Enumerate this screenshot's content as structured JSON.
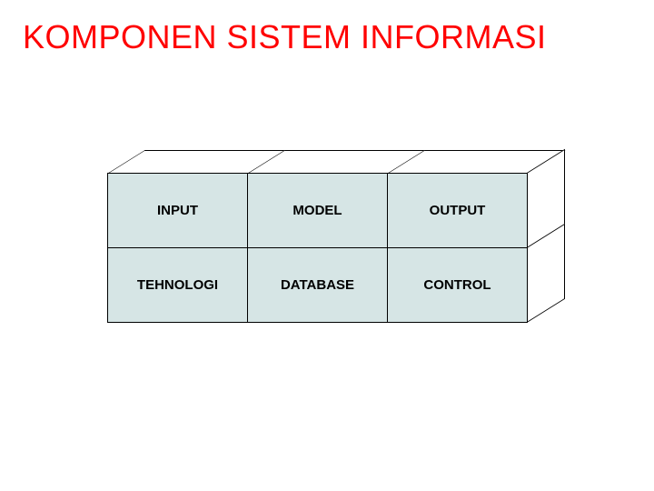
{
  "title": "KOMPONEN SISTEM INFORMASI",
  "cells": {
    "r0c0": "INPUT",
    "r0c1": "MODEL",
    "r0c2": "OUTPUT",
    "r1c0": "TEHNOLOGI",
    "r1c1": "DATABASE",
    "r1c2": "CONTROL"
  }
}
